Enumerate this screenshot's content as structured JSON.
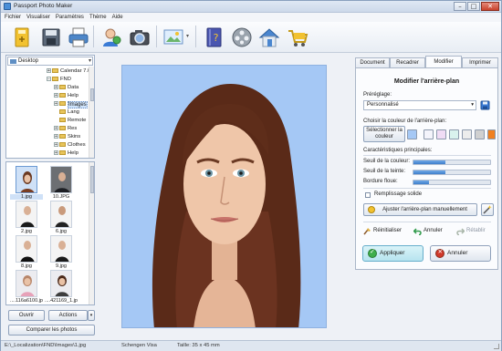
{
  "window": {
    "title": "Passport Photo Maker"
  },
  "menu": [
    "Fichier",
    "Visualiser",
    "Paramètres",
    "Thème",
    "Aide"
  ],
  "toolbar": {
    "icons": [
      "open-icon",
      "save-icon",
      "print-icon",
      "wizard-icon",
      "camera-icon",
      "crop-tool-icon",
      "help-book-icon",
      "video-reel-icon",
      "home-icon",
      "cart-icon"
    ]
  },
  "tree": {
    "drive": "Desktop",
    "items": [
      "Calendar 7.0",
      "FND",
      "Data",
      "Help",
      "Images",
      "Lang",
      "Remote",
      "Res",
      "Skins",
      "Clothes",
      "Help"
    ]
  },
  "thumbnails": [
    {
      "caption": "1.jpg",
      "selected": true
    },
    {
      "caption": "10.JPG"
    },
    {
      "caption": "2.jpg"
    },
    {
      "caption": "6.jpg"
    },
    {
      "caption": "8.jpg"
    },
    {
      "caption": "9.jpg"
    },
    {
      "caption": "....116a6100.jpg"
    },
    {
      "caption": "....421169_1.jpg"
    }
  ],
  "left_buttons": {
    "open": "Ouvrir",
    "actions": "Actions",
    "compare": "Comparer les photos"
  },
  "tabs": [
    "Document",
    "Recadrer",
    "Modifier",
    "Imprimer"
  ],
  "active_tab": "Modifier",
  "panel": {
    "heading": "Modifier l'arrière-plan",
    "preset_label": "Préréglage:",
    "preset_value": "Personnalisé",
    "color_label": "Choisir la couleur de l'arrière-plan:",
    "select_color_line1": "Sélectionner la",
    "select_color_line2": "couleur",
    "swatches": [
      "#a5c8f5",
      "#f4f4fb",
      "#f0dcf5",
      "#d9f2ee",
      "#ececec",
      "#d0d0d0",
      "#f08020"
    ],
    "main_label": "Caractéristiques principales:",
    "color_threshold": "Seuil de la couleur:",
    "tint_threshold": "Seuil de la teinte:",
    "blur_border": "Bordure floue:",
    "color_threshold_value": 0.42,
    "tint_threshold_value": 0.42,
    "blur_border_value": 0.2,
    "fill_solid": "Remplissage solide",
    "manual_adjust": "Ajuster l'arrière-plan manuellement",
    "reset": "Réinitialiser",
    "undo": "Annuler",
    "redo": "Rétablir",
    "apply": "Appliquer",
    "cancel": "Annuler"
  },
  "status": {
    "path": "E:\\_Localization\\FND\\Images\\1.jpg",
    "template": "Schengen Visa",
    "size": "Taille: 35 x 45 mm"
  },
  "colors": {
    "background_blue": "#a5c8f5",
    "apply_green": "#3fae4c",
    "cancel_red": "#d0392b"
  }
}
